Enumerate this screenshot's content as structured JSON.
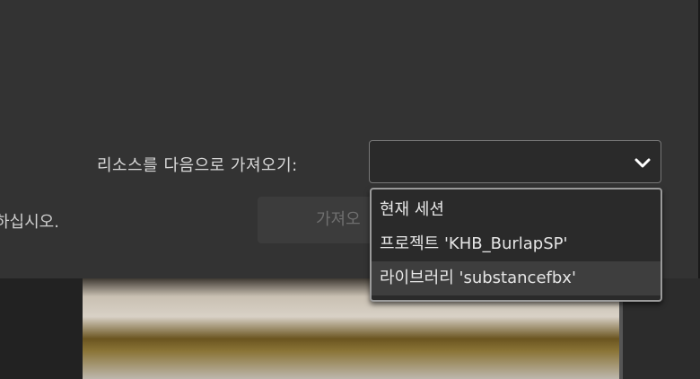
{
  "dialog": {
    "import_label": "리소스를 다음으로 가져오기:",
    "helper_text_partial": "하십시오.",
    "import_button_partial": "가져오",
    "select_value": ""
  },
  "dropdown": {
    "options": [
      {
        "label": "현재 세션"
      },
      {
        "label": "프로젝트 'KHB_BurlapSP'"
      },
      {
        "label": "라이브러리 'substancefbx'"
      }
    ],
    "selected_index": 2
  },
  "icons": {
    "select_chevron": "chevron-down-icon"
  }
}
